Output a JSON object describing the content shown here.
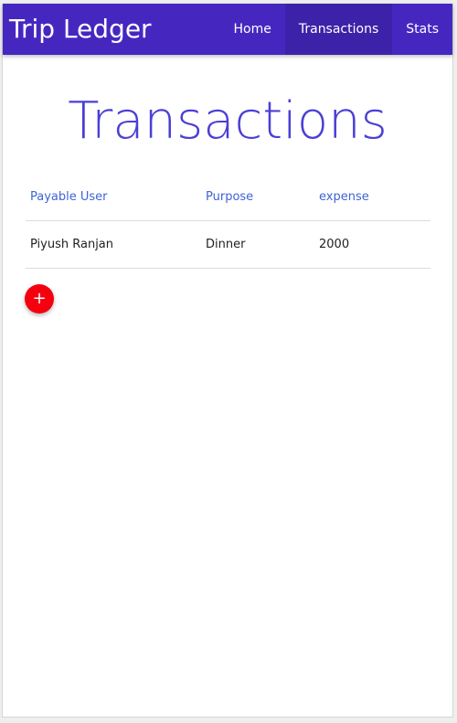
{
  "app": {
    "brand": "Trip Ledger",
    "accent_color": "#4527c0",
    "title_color": "#4a3fd6",
    "header_text_color": "#3f63d6",
    "fab_color": "#f4000f"
  },
  "nav": {
    "items": [
      {
        "label": "Home",
        "active": false
      },
      {
        "label": "Transactions",
        "active": true
      },
      {
        "label": "Stats",
        "active": false
      }
    ]
  },
  "page": {
    "title": "Transactions"
  },
  "table": {
    "headers": [
      "Payable User",
      "Purpose",
      "expense"
    ],
    "rows": [
      [
        "Piyush Ranjan",
        "Dinner",
        "2000"
      ]
    ]
  },
  "fab": {
    "icon": "plus-icon",
    "glyph": "+"
  }
}
